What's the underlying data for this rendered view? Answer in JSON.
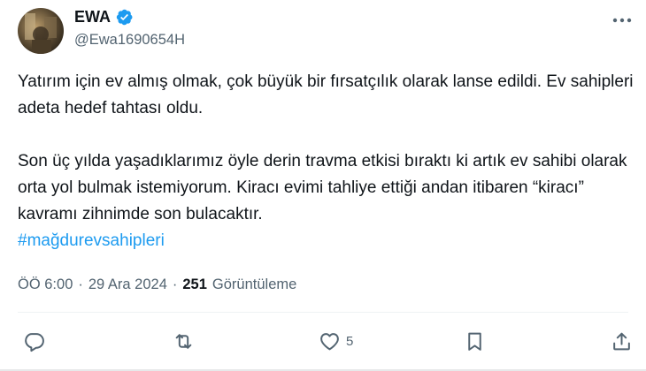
{
  "author": {
    "display_name": "EWA",
    "handle": "@Ewa1690654H",
    "verified": true
  },
  "tweet": {
    "paragraph_1": "Yatırım için ev almış olmak, çok büyük bir fırsatçılık olarak lanse edildi. Ev sahipleri adeta hedef tahtası oldu.",
    "paragraph_2_line_1": "Son üç yılda yaşadıklarımız öyle derin travma etkisi bıraktı ki artık ev sahibi olarak orta yol bulmak istemiyorum. Kiracı evimi tahliye ettiği andan itibaren  “kiracı” kavramı zihnimde son bulacaktır.",
    "hashtag": "#mağdurevsahipleri"
  },
  "meta": {
    "time": "ÖÖ 6:00",
    "separator": "·",
    "date": "29 Ara 2024",
    "views_count": "251",
    "views_label": "Görüntüleme"
  },
  "actions": {
    "reply_count": "",
    "retweet_count": "",
    "like_count": "5",
    "bookmark_count": "",
    "share_count": ""
  },
  "colors": {
    "accent": "#1d9bf0",
    "secondary_text": "#536471",
    "primary_text": "#0f1419"
  }
}
